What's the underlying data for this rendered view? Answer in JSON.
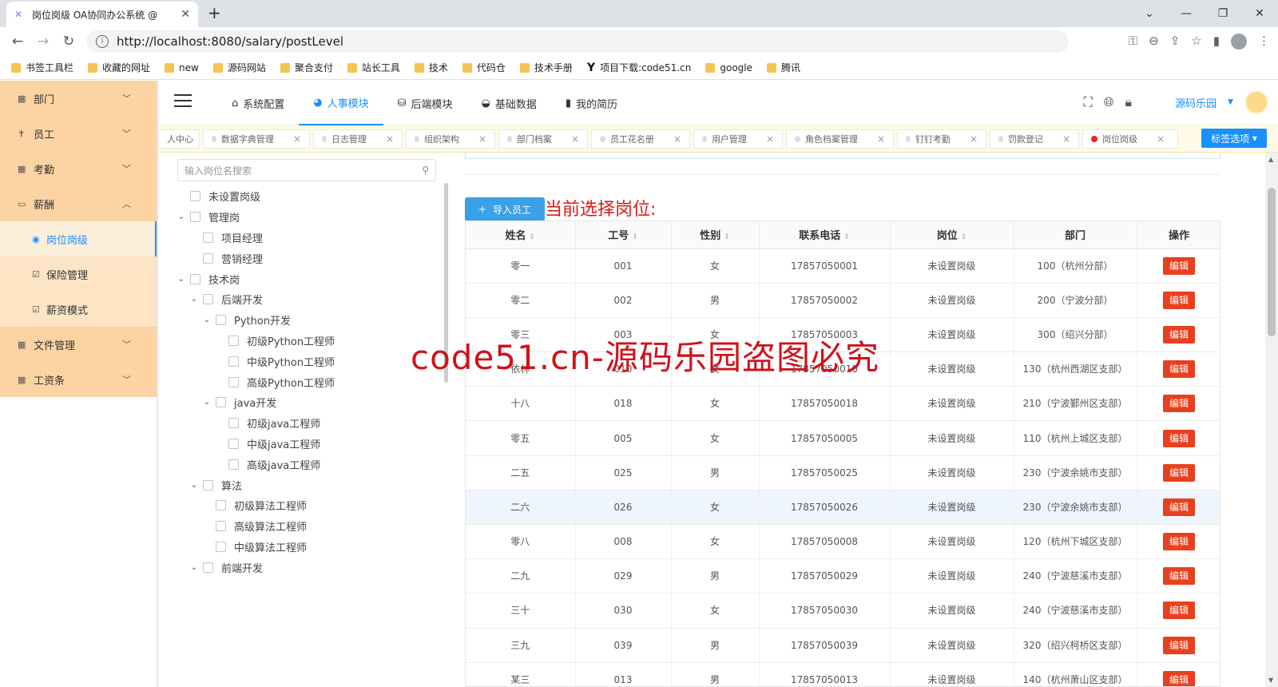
{
  "browser": {
    "tab_title": "岗位岗级 OA协同办公系统 @",
    "url": "http://localhost:8080/salary/postLevel",
    "bookmarks": [
      "书签工具栏",
      "收藏的网址",
      "new",
      "源码网站",
      "聚合支付",
      "站长工具",
      "技术",
      "代码仓",
      "技术手册",
      "项目下载:code51.cn",
      "google",
      "腾讯"
    ]
  },
  "sidebar": {
    "items": [
      {
        "label": "部门",
        "icon": "building-icon"
      },
      {
        "label": "员工",
        "icon": "person-icon"
      },
      {
        "label": "考勤",
        "icon": "calendar-icon"
      },
      {
        "label": "薪酬",
        "icon": "wallet-icon"
      }
    ],
    "sub_items": [
      {
        "label": "岗位岗级",
        "icon": "badge-icon"
      },
      {
        "label": "保险管理",
        "icon": "check-icon"
      },
      {
        "label": "薪资模式",
        "icon": "check-icon"
      }
    ],
    "bottom_items": [
      {
        "label": "文件管理",
        "icon": "grid-icon"
      },
      {
        "label": "工资条",
        "icon": "grid-icon"
      }
    ]
  },
  "header": {
    "nav": [
      {
        "label": "系统配置",
        "icon": "home-icon"
      },
      {
        "label": "人事模块",
        "icon": "people-icon"
      },
      {
        "label": "后端模块",
        "icon": "server-icon"
      },
      {
        "label": "基础数据",
        "icon": "database-icon"
      },
      {
        "label": "我的简历",
        "icon": "book-icon"
      }
    ],
    "username": "源码乐园"
  },
  "tags": {
    "items": [
      "人中心",
      "数据字典管理",
      "日志管理",
      "组织架构",
      "部门档案",
      "员工花名册",
      "用户管理",
      "角色档案管理",
      "钉钉考勤",
      "罚款登记",
      "岗位岗级"
    ],
    "select_label": "标签选项"
  },
  "tree": {
    "search_placeholder": "输入岗位名搜索",
    "nodes": [
      {
        "label": "未设置岗级",
        "level": 0,
        "arrow": ""
      },
      {
        "label": "管理岗",
        "level": 0,
        "arrow": "v"
      },
      {
        "label": "项目经理",
        "level": 1,
        "arrow": ""
      },
      {
        "label": "营销经理",
        "level": 1,
        "arrow": ""
      },
      {
        "label": "技术岗",
        "level": 0,
        "arrow": "v"
      },
      {
        "label": "后端开发",
        "level": 1,
        "arrow": "v"
      },
      {
        "label": "Python开发",
        "level": 2,
        "arrow": "v"
      },
      {
        "label": "初级Python工程师",
        "level": 3,
        "arrow": ""
      },
      {
        "label": "中级Python工程师",
        "level": 3,
        "arrow": ""
      },
      {
        "label": "高级Python工程师",
        "level": 3,
        "arrow": ""
      },
      {
        "label": "java开发",
        "level": 2,
        "arrow": "v"
      },
      {
        "label": "初级java工程师",
        "level": 3,
        "arrow": ""
      },
      {
        "label": "中级java工程师",
        "level": 3,
        "arrow": ""
      },
      {
        "label": "高级java工程师",
        "level": 3,
        "arrow": ""
      },
      {
        "label": "算法",
        "level": 1,
        "arrow": "v"
      },
      {
        "label": "初级算法工程师",
        "level": 2,
        "arrow": ""
      },
      {
        "label": "高级算法工程师",
        "level": 2,
        "arrow": ""
      },
      {
        "label": "中级算法工程师",
        "level": 2,
        "arrow": ""
      },
      {
        "label": "前端开发",
        "level": 1,
        "arrow": "v"
      }
    ]
  },
  "content": {
    "import_label": "导入员工",
    "current_label": "当前选择岗位:",
    "watermark": "code51.cn-源码乐园盗图必究",
    "columns": [
      "姓名",
      "工号",
      "性别",
      "联系电话",
      "岗位",
      "部门",
      "操作"
    ],
    "edit_label": "编辑",
    "rows": [
      [
        "零一",
        "001",
        "女",
        "17857050001",
        "未设置岗级",
        "100（杭州分部）"
      ],
      [
        "零二",
        "002",
        "男",
        "17857050002",
        "未设置岗级",
        "200（宁波分部）"
      ],
      [
        "零三",
        "003",
        "女",
        "17857050003",
        "未设置岗级",
        "300（绍兴分部）"
      ],
      [
        "依林",
        "010",
        "女",
        "17857050010",
        "未设置岗级",
        "130（杭州西湖区支部）"
      ],
      [
        "十八",
        "018",
        "女",
        "17857050018",
        "未设置岗级",
        "210（宁波鄞州区支部）"
      ],
      [
        "零五",
        "005",
        "女",
        "17857050005",
        "未设置岗级",
        "110（杭州上城区支部）"
      ],
      [
        "二五",
        "025",
        "男",
        "17857050025",
        "未设置岗级",
        "230（宁波余姚市支部）"
      ],
      [
        "二六",
        "026",
        "女",
        "17857050026",
        "未设置岗级",
        "230（宁波余姚市支部）"
      ],
      [
        "零八",
        "008",
        "女",
        "17857050008",
        "未设置岗级",
        "120（杭州下城区支部）"
      ],
      [
        "二九",
        "029",
        "男",
        "17857050029",
        "未设置岗级",
        "240（宁波慈溪市支部）"
      ],
      [
        "三十",
        "030",
        "女",
        "17857050030",
        "未设置岗级",
        "240（宁波慈溪市支部）"
      ],
      [
        "三九",
        "039",
        "男",
        "17857050039",
        "未设置岗级",
        "320（绍兴柯桥区支部）"
      ],
      [
        "某三",
        "013",
        "男",
        "17857050013",
        "未设置岗级",
        "140（杭州萧山区支部）"
      ]
    ],
    "highlight_row": 7
  }
}
